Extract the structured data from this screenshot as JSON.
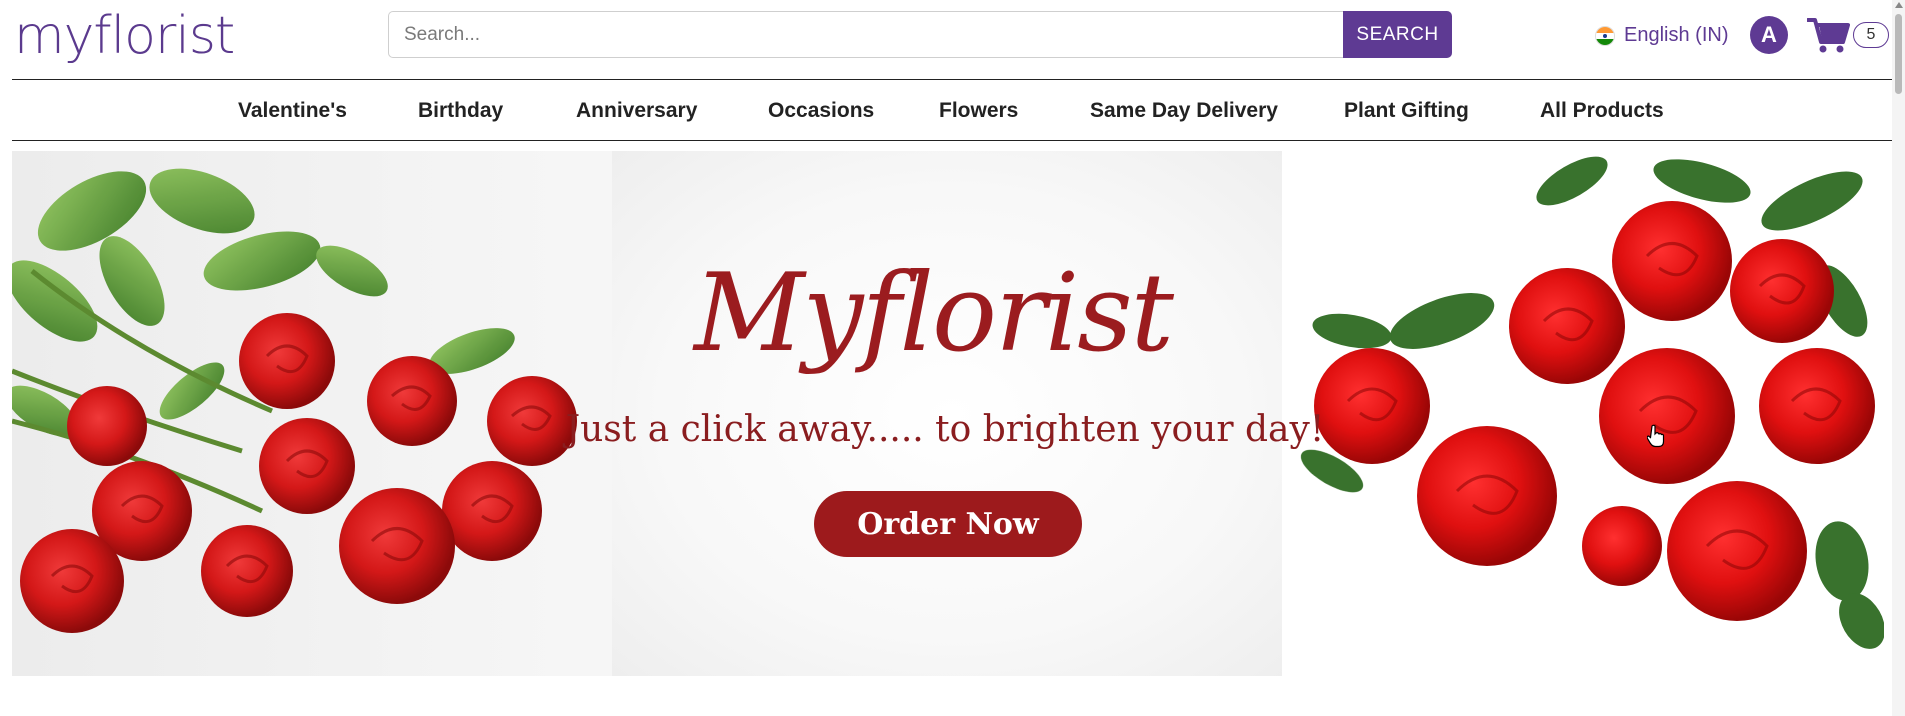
{
  "header": {
    "logo_text": "myflorist",
    "search": {
      "placeholder": "Search...",
      "button_label": "SEARCH"
    },
    "language": {
      "label": "English (IN)",
      "flag_icon": "india-flag-icon"
    },
    "user": {
      "avatar_initial": "A"
    },
    "cart": {
      "count": "5",
      "icon": "shopping-cart-icon"
    }
  },
  "nav": {
    "items": [
      {
        "label": "Valentine's"
      },
      {
        "label": "Birthday"
      },
      {
        "label": "Anniversary"
      },
      {
        "label": "Occasions"
      },
      {
        "label": "Flowers"
      },
      {
        "label": "Same Day Delivery"
      },
      {
        "label": "Plant Gifting"
      },
      {
        "label": "All Products"
      }
    ]
  },
  "banner": {
    "title": "Myflorist",
    "tagline": "Just a click away..... to brighten your day!",
    "cta_label": "Order Now"
  },
  "colors": {
    "brand_purple": "#5e3a93",
    "banner_red": "#9d1a1c",
    "rose_red": "#d81e1e",
    "leaf_green": "#4a8a2a"
  }
}
